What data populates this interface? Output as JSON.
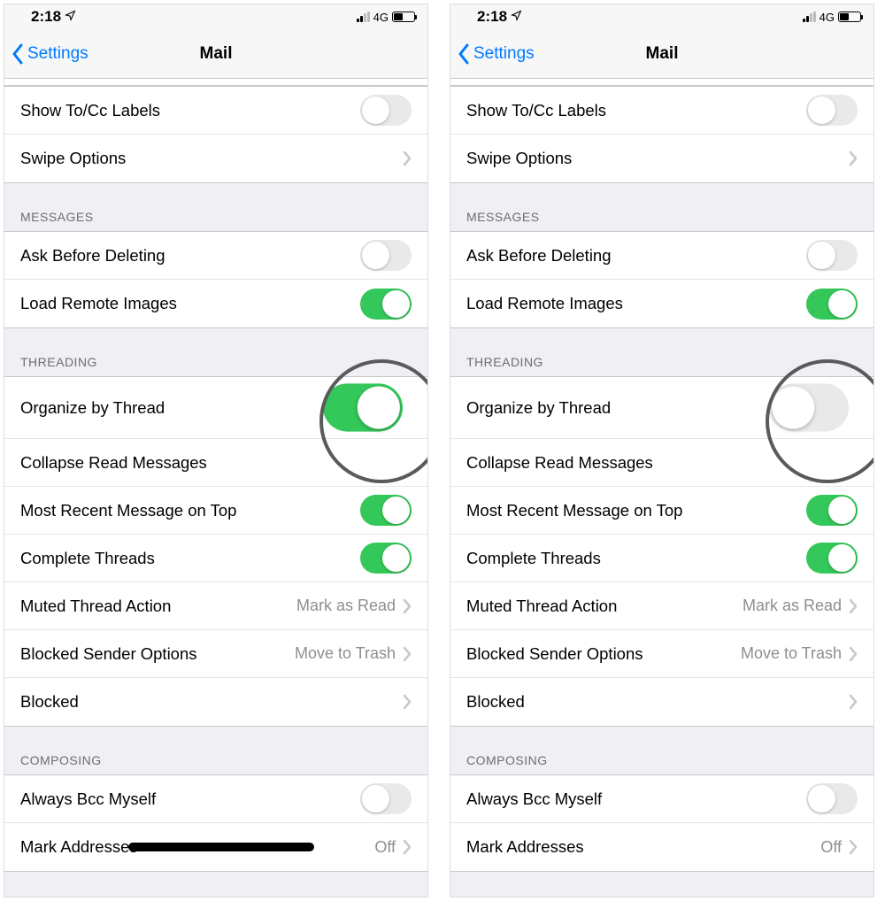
{
  "status": {
    "time": "2:18",
    "network": "4G"
  },
  "nav": {
    "back": "Settings",
    "title": "Mail"
  },
  "sections": {
    "top": {
      "show_to_cc": "Show To/Cc Labels",
      "swipe_options": "Swipe Options"
    },
    "messages": {
      "header": "MESSAGES",
      "ask_before_deleting": "Ask Before Deleting",
      "load_remote_images": "Load Remote Images"
    },
    "threading": {
      "header": "THREADING",
      "organize_by_thread": "Organize by Thread",
      "collapse_read_messages": "Collapse Read Messages",
      "most_recent_on_top": "Most Recent Message on Top",
      "complete_threads": "Complete Threads",
      "muted_thread_action": "Muted Thread Action",
      "muted_thread_value": "Mark as Read",
      "blocked_sender_options": "Blocked Sender Options",
      "blocked_sender_value": "Move to Trash",
      "blocked": "Blocked"
    },
    "composing": {
      "header": "COMPOSING",
      "always_bcc_myself": "Always Bcc Myself",
      "mark_addresses": "Mark Addresses",
      "mark_addresses_value": "Off"
    }
  },
  "toggles": {
    "left": {
      "show_to_cc": false,
      "ask_before_deleting": false,
      "load_remote_images": true,
      "organize_by_thread": true,
      "most_recent_on_top": true,
      "complete_threads": true,
      "always_bcc_myself": false
    },
    "right": {
      "show_to_cc": false,
      "ask_before_deleting": false,
      "load_remote_images": true,
      "organize_by_thread": false,
      "most_recent_on_top": true,
      "complete_threads": true,
      "always_bcc_myself": false
    }
  }
}
